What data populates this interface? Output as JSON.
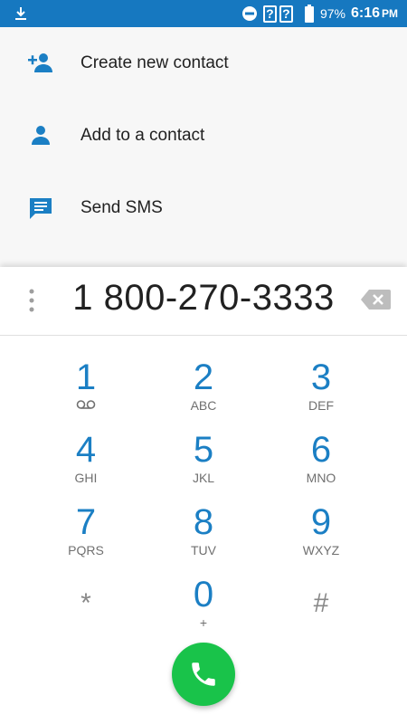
{
  "status_bar": {
    "battery": "97%",
    "time": "6:16",
    "ampm": "PM",
    "unknown_icon_1": "?",
    "unknown_icon_2": "?",
    "color": "#1678c0"
  },
  "actions": [
    {
      "label": "Create new contact",
      "icon": "add-person-icon"
    },
    {
      "label": "Add to a contact",
      "icon": "person-icon"
    },
    {
      "label": "Send SMS",
      "icon": "message-icon"
    }
  ],
  "dialer": {
    "number": "1 800-270-3333",
    "keys": [
      {
        "digit": "1",
        "letters": ""
      },
      {
        "digit": "2",
        "letters": "ABC"
      },
      {
        "digit": "3",
        "letters": "DEF"
      },
      {
        "digit": "4",
        "letters": "GHI"
      },
      {
        "digit": "5",
        "letters": "JKL"
      },
      {
        "digit": "6",
        "letters": "MNO"
      },
      {
        "digit": "7",
        "letters": "PQRS"
      },
      {
        "digit": "8",
        "letters": "TUV"
      },
      {
        "digit": "9",
        "letters": "WXYZ"
      },
      {
        "digit": "*",
        "letters": ""
      },
      {
        "digit": "0",
        "letters": "+"
      },
      {
        "digit": "#",
        "letters": ""
      }
    ],
    "accent_color": "#1b7fc4",
    "call_color": "#19c34a"
  }
}
